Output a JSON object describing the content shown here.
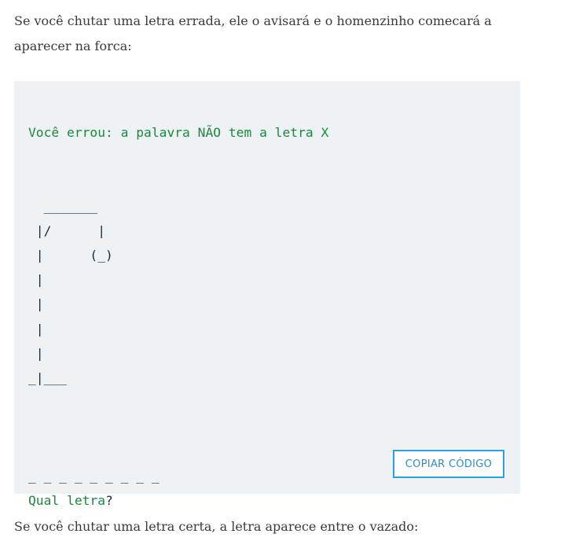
{
  "intro_text": "Se você chutar uma letra errada, ele o avisará e o homenzinho comecará a aparecer na forca:",
  "code": {
    "message": "Você errou: a palavra NÃO tem a letra X",
    "gallows_lines": [
      "  _______",
      " |/      |",
      " |      (_)",
      " |",
      " |",
      " |",
      " |",
      "_|___"
    ],
    "blanks": "_ _ _ _ _ _ _ _ _",
    "prompt_word": "Qual letra",
    "prompt_mark": "?"
  },
  "copy_button_label": "COPIAR CÓDIGO",
  "outro_text": "Se você chutar uma letra certa, a letra aparece entre o vazado:"
}
